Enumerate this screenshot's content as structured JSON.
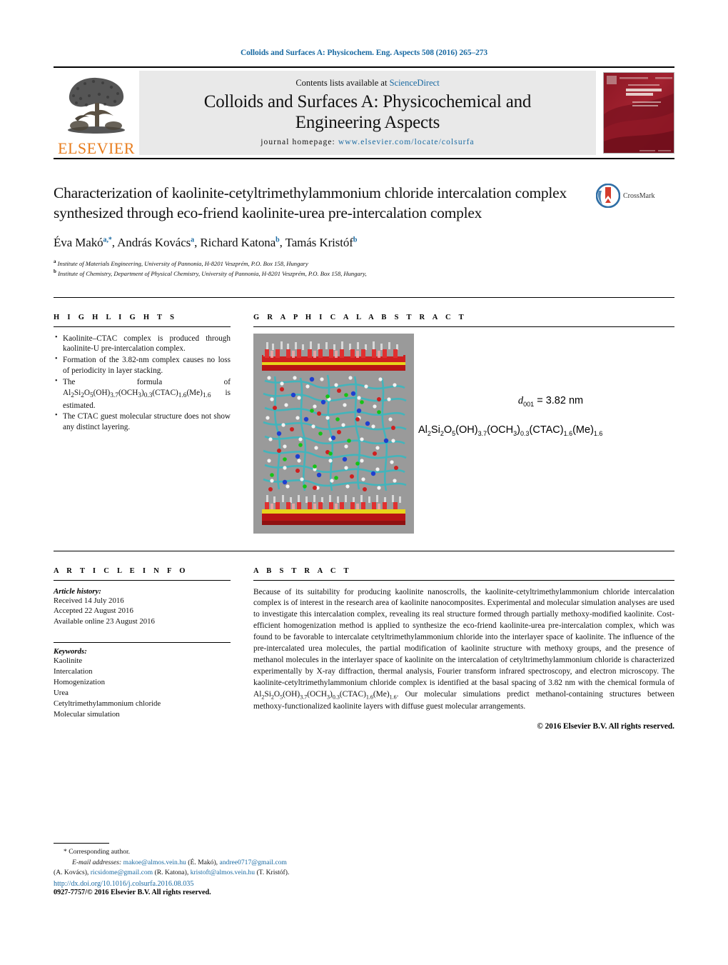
{
  "running_head": "Colloids and Surfaces A: Physicochem. Eng. Aspects 508 (2016) 265–273",
  "masthead": {
    "publisher_logo_text": "ELSEVIER",
    "contents_prefix": "Contents lists available at ",
    "contents_link": "ScienceDirect",
    "journal_title_line1": "Colloids and Surfaces A: Physicochemical and",
    "journal_title_line2": "Engineering Aspects",
    "homepage_label": "journal homepage: ",
    "homepage_url": "www.elsevier.com/locate/colsurfa",
    "cover_journal_name": "COLLOIDS AND SURFACES A",
    "cover_subtitle": "Physicochemical and Engineering Aspects"
  },
  "article": {
    "title": "Characterization of kaolinite-cetyltrimethylammonium chloride intercalation complex synthesized through eco-friend kaolinite-urea pre-intercalation complex",
    "authors": [
      {
        "name": "Éva Makó",
        "marks": "a,*"
      },
      {
        "name": "András Kovács",
        "marks": "a"
      },
      {
        "name": "Richard Katona",
        "marks": "b"
      },
      {
        "name": "Tamás Kristóf",
        "marks": "b"
      }
    ],
    "affiliations": [
      {
        "mark": "a",
        "text": "Institute of Materials Engineering, University of Pannonia, H-8201 Veszprém, P.O. Box 158, Hungary"
      },
      {
        "mark": "b",
        "text": "Institute of Chemistry, Department of Physical Chemistry, University of Pannonia, H-8201 Veszprém, P.O. Box 158, Hungary,"
      }
    ],
    "crossmark_label": "CrossMark"
  },
  "highlights": {
    "heading": "H I G H L I G H T S",
    "items": [
      "Kaolinite–CTAC complex is produced through kaolinite-U pre-intercalation complex.",
      "Formation of the 3.82-nm complex causes no loss of periodicity in layer stacking.",
      "The formula of Al2Si2O5(OH)3.7(OCH3)0.3(CTAC)1.6(Me)1.6 is estimated.",
      "The CTAC guest molecular structure does not show any distinct layering."
    ]
  },
  "graphical_abstract": {
    "heading": "G R A P H I C A L   A B S T R A C T",
    "d001_label": "d",
    "d001_sub": "001",
    "d001_value": " = 3.82 nm",
    "formula": "Al2Si2O5(OH)3.7(OCH3)0.3(CTAC)1.6(Me)1.6"
  },
  "article_info": {
    "heading": "A R T I C L E   I N F O",
    "history_label": "Article history:",
    "history": [
      "Received 14 July 2016",
      "Accepted 22 August 2016",
      "Available online 23 August 2016"
    ],
    "keywords_label": "Keywords:",
    "keywords": [
      "Kaolinite",
      "Intercalation",
      "Homogenization",
      "Urea",
      "Cetyltrimethylammonium chloride",
      "Molecular simulation"
    ]
  },
  "abstract": {
    "heading": "A B S T R A C T",
    "text": "Because of its suitability for producing kaolinite nanoscrolls, the kaolinite-cetyltrimethylammonium chloride intercalation complex is of interest in the research area of kaolinite nanocomposites. Experimental and molecular simulation analyses are used to investigate this intercalation complex, revealing its real structure formed through partially methoxy-modified kaolinite. Cost-efficient homogenization method is applied to synthesize the eco-friend kaolinite-urea pre-intercalation complex, which was found to be favorable to intercalate cetyltrimethylammonium chloride into the interlayer space of kaolinite. The influence of the pre-intercalated urea molecules, the partial modification of kaolinite structure with methoxy groups, and the presence of methanol molecules in the interlayer space of kaolinite on the intercalation of cetyltrimethylammonium chloride is characterized experimentally by X-ray diffraction, thermal analysis, Fourier transform infrared spectroscopy, and electron microscopy. The kaolinite-cetyltrimethylammonium chloride complex is identified at the basal spacing of 3.82 nm with the chemical formula of Al2Si2O5(OH)3.7(OCH3)0.3(CTAC)1.6(Me)1.6. Our molecular simulations predict methanol-containing structures between methoxy-functionalized kaolinite layers with diffuse guest molecular arrangements.",
    "copyright": "© 2016 Elsevier B.V. All rights reserved."
  },
  "footer": {
    "corresponding_marker": "*",
    "corresponding_text": "Corresponding author.",
    "email_label": "E-mail addresses:",
    "emails": [
      {
        "address": "makoe@almos.vein.hu",
        "owner": "(É. Makó),"
      },
      {
        "address": "andree0717@gmail.com",
        "owner": "(A. Kovács),"
      },
      {
        "address": "ricsidome@gmail.com",
        "owner": "(R. Katona),"
      },
      {
        "address": "kristoft@almos.vein.hu",
        "owner": "(T. Kristóf)."
      }
    ],
    "doi": "http://dx.doi.org/10.1016/j.colsurfa.2016.08.035",
    "issn_line": "0927-7757/© 2016 Elsevier B.V. All rights reserved."
  },
  "colors": {
    "link": "#1a6aa2",
    "elsevier_orange": "#e87d1e",
    "band_gray": "#e9e9e9",
    "figure_bg": "#9a9a9a"
  }
}
